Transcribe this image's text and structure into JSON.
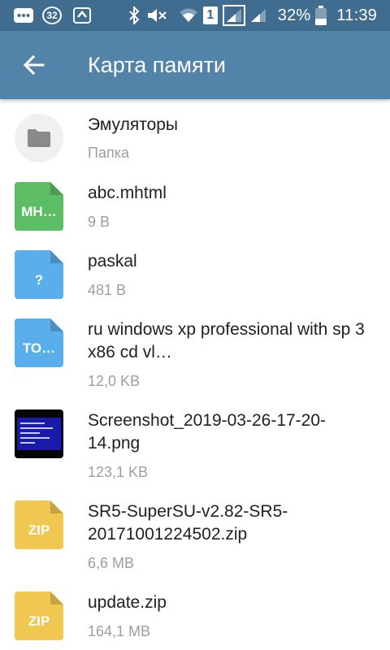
{
  "status_bar": {
    "notification_count": "32",
    "sim_label": "1",
    "battery_percent": "32%",
    "clock": "11:39",
    "icons": [
      "messages-icon",
      "notification-count-icon",
      "sync-icon",
      "bluetooth-icon",
      "mute-icon",
      "wifi-icon",
      "sim-icon",
      "signal-icon",
      "signal-icon",
      "battery-icon"
    ]
  },
  "app_bar": {
    "back_icon": "back-arrow-icon",
    "title": "Карта памяти"
  },
  "colors": {
    "status_bar": "#3f6c8f",
    "app_bar": "#5283a9",
    "green_doc": "#5cbd65",
    "blue_doc": "#5aaeea",
    "yellow_zip": "#f0c851",
    "name_text": "#212121",
    "meta_text": "#9e9e9e"
  },
  "files": [
    {
      "icon": "folder-icon",
      "type": "folder",
      "name": "Эмуляторы",
      "meta": "Папка"
    },
    {
      "icon": "document-icon",
      "type": "doc",
      "badge": "MH…",
      "color": "#5cbd65",
      "name": "abc.mhtml",
      "meta": "9 B"
    },
    {
      "icon": "document-icon",
      "type": "doc",
      "badge": "?",
      "color": "#5aaeea",
      "name": "paskal",
      "meta": "481 B"
    },
    {
      "icon": "document-icon",
      "type": "doc",
      "badge": "TO…",
      "color": "#5aaeea",
      "name": "ru windows xp professional with sp 3 x86 cd vl…",
      "meta": "12,0 KB"
    },
    {
      "icon": "image-thumbnail-icon",
      "type": "image",
      "name": "Screenshot_2019-03-26-17-20-14.png",
      "meta": "123,1 KB"
    },
    {
      "icon": "zip-icon",
      "type": "doc",
      "badge": "ZIP",
      "color": "#f0c851",
      "name": "SR5-SuperSU-v2.82-SR5-20171001224502.zip",
      "meta": "6,6 MB"
    },
    {
      "icon": "zip-icon",
      "type": "doc",
      "badge": "ZIP",
      "color": "#f0c851",
      "name": "update.zip",
      "meta": "164,1 MB"
    }
  ]
}
